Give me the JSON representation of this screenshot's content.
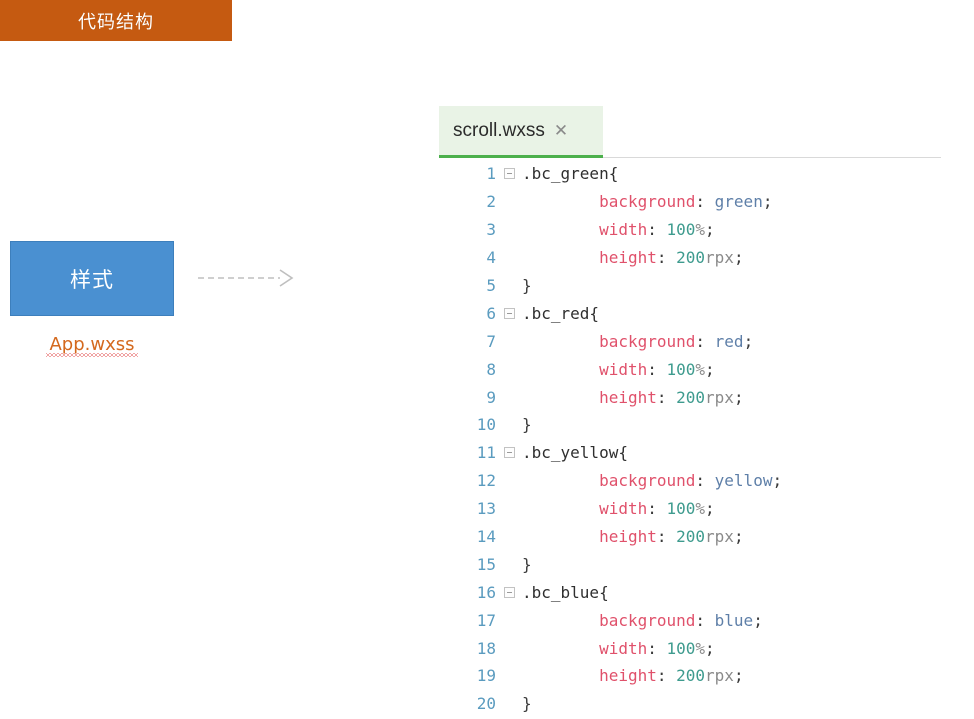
{
  "slide": {
    "title": "代码结构",
    "title_bg_color": "#C55A11"
  },
  "diagram": {
    "node_label": "样式",
    "node_color": "#4A90D1",
    "node_caption": "App.wxss",
    "caption_color": "#D4691E",
    "arrow": "dashed-right-arrow"
  },
  "editor": {
    "tab_label": "scroll.wxss",
    "tab_close_glyph": "✕",
    "tab_accent_color": "#4CB04C",
    "lines": [
      {
        "num": "1",
        "fold": true,
        "indent": 0,
        "tokens": [
          {
            "t": ".bc_green{",
            "c": "tok-sel"
          }
        ]
      },
      {
        "num": "2",
        "fold": false,
        "indent": 2,
        "tokens": [
          {
            "t": "background",
            "c": "tok-prop"
          },
          {
            "t": ": ",
            "c": "tok-punc"
          },
          {
            "t": "green",
            "c": "tok-ident"
          },
          {
            "t": ";",
            "c": "tok-punc"
          }
        ]
      },
      {
        "num": "3",
        "fold": false,
        "indent": 2,
        "tokens": [
          {
            "t": "width",
            "c": "tok-prop"
          },
          {
            "t": ": ",
            "c": "tok-punc"
          },
          {
            "t": "100",
            "c": "tok-num"
          },
          {
            "t": "%",
            "c": "tok-unit"
          },
          {
            "t": ";",
            "c": "tok-punc"
          }
        ]
      },
      {
        "num": "4",
        "fold": false,
        "indent": 2,
        "tokens": [
          {
            "t": "height",
            "c": "tok-prop"
          },
          {
            "t": ": ",
            "c": "tok-punc"
          },
          {
            "t": "200",
            "c": "tok-num"
          },
          {
            "t": "rpx",
            "c": "tok-unit"
          },
          {
            "t": ";",
            "c": "tok-punc"
          }
        ]
      },
      {
        "num": "5",
        "fold": false,
        "indent": 0,
        "tokens": [
          {
            "t": "}",
            "c": "tok-brace"
          }
        ]
      },
      {
        "num": "6",
        "fold": true,
        "indent": 0,
        "tokens": [
          {
            "t": ".bc_red{",
            "c": "tok-sel"
          }
        ]
      },
      {
        "num": "7",
        "fold": false,
        "indent": 2,
        "tokens": [
          {
            "t": "background",
            "c": "tok-prop"
          },
          {
            "t": ": ",
            "c": "tok-punc"
          },
          {
            "t": "red",
            "c": "tok-ident"
          },
          {
            "t": ";",
            "c": "tok-punc"
          }
        ]
      },
      {
        "num": "8",
        "fold": false,
        "indent": 2,
        "tokens": [
          {
            "t": "width",
            "c": "tok-prop"
          },
          {
            "t": ": ",
            "c": "tok-punc"
          },
          {
            "t": "100",
            "c": "tok-num"
          },
          {
            "t": "%",
            "c": "tok-unit"
          },
          {
            "t": ";",
            "c": "tok-punc"
          }
        ]
      },
      {
        "num": "9",
        "fold": false,
        "indent": 2,
        "tokens": [
          {
            "t": "height",
            "c": "tok-prop"
          },
          {
            "t": ": ",
            "c": "tok-punc"
          },
          {
            "t": "200",
            "c": "tok-num"
          },
          {
            "t": "rpx",
            "c": "tok-unit"
          },
          {
            "t": ";",
            "c": "tok-punc"
          }
        ]
      },
      {
        "num": "10",
        "fold": false,
        "indent": 0,
        "tokens": [
          {
            "t": "}",
            "c": "tok-brace"
          }
        ]
      },
      {
        "num": "11",
        "fold": true,
        "indent": 0,
        "tokens": [
          {
            "t": ".bc_yellow{",
            "c": "tok-sel"
          }
        ]
      },
      {
        "num": "12",
        "fold": false,
        "indent": 2,
        "tokens": [
          {
            "t": "background",
            "c": "tok-prop"
          },
          {
            "t": ": ",
            "c": "tok-punc"
          },
          {
            "t": "yellow",
            "c": "tok-ident"
          },
          {
            "t": ";",
            "c": "tok-punc"
          }
        ]
      },
      {
        "num": "13",
        "fold": false,
        "indent": 2,
        "tokens": [
          {
            "t": "width",
            "c": "tok-prop"
          },
          {
            "t": ": ",
            "c": "tok-punc"
          },
          {
            "t": "100",
            "c": "tok-num"
          },
          {
            "t": "%",
            "c": "tok-unit"
          },
          {
            "t": ";",
            "c": "tok-punc"
          }
        ]
      },
      {
        "num": "14",
        "fold": false,
        "indent": 2,
        "tokens": [
          {
            "t": "height",
            "c": "tok-prop"
          },
          {
            "t": ": ",
            "c": "tok-punc"
          },
          {
            "t": "200",
            "c": "tok-num"
          },
          {
            "t": "rpx",
            "c": "tok-unit"
          },
          {
            "t": ";",
            "c": "tok-punc"
          }
        ]
      },
      {
        "num": "15",
        "fold": false,
        "indent": 0,
        "tokens": [
          {
            "t": "}",
            "c": "tok-brace"
          }
        ]
      },
      {
        "num": "16",
        "fold": true,
        "indent": 0,
        "tokens": [
          {
            "t": ".bc_blue{",
            "c": "tok-sel"
          }
        ]
      },
      {
        "num": "17",
        "fold": false,
        "indent": 2,
        "tokens": [
          {
            "t": "background",
            "c": "tok-prop"
          },
          {
            "t": ": ",
            "c": "tok-punc"
          },
          {
            "t": "blue",
            "c": "tok-ident"
          },
          {
            "t": ";",
            "c": "tok-punc"
          }
        ]
      },
      {
        "num": "18",
        "fold": false,
        "indent": 2,
        "tokens": [
          {
            "t": "width",
            "c": "tok-prop"
          },
          {
            "t": ": ",
            "c": "tok-punc"
          },
          {
            "t": "100",
            "c": "tok-num"
          },
          {
            "t": "%",
            "c": "tok-unit"
          },
          {
            "t": ";",
            "c": "tok-punc"
          }
        ]
      },
      {
        "num": "19",
        "fold": false,
        "indent": 2,
        "tokens": [
          {
            "t": "height",
            "c": "tok-prop"
          },
          {
            "t": ": ",
            "c": "tok-punc"
          },
          {
            "t": "200",
            "c": "tok-num"
          },
          {
            "t": "rpx",
            "c": "tok-unit"
          },
          {
            "t": ";",
            "c": "tok-punc"
          }
        ]
      },
      {
        "num": "20",
        "fold": false,
        "indent": 0,
        "tokens": [
          {
            "t": "}",
            "c": "tok-brace"
          }
        ]
      }
    ]
  }
}
